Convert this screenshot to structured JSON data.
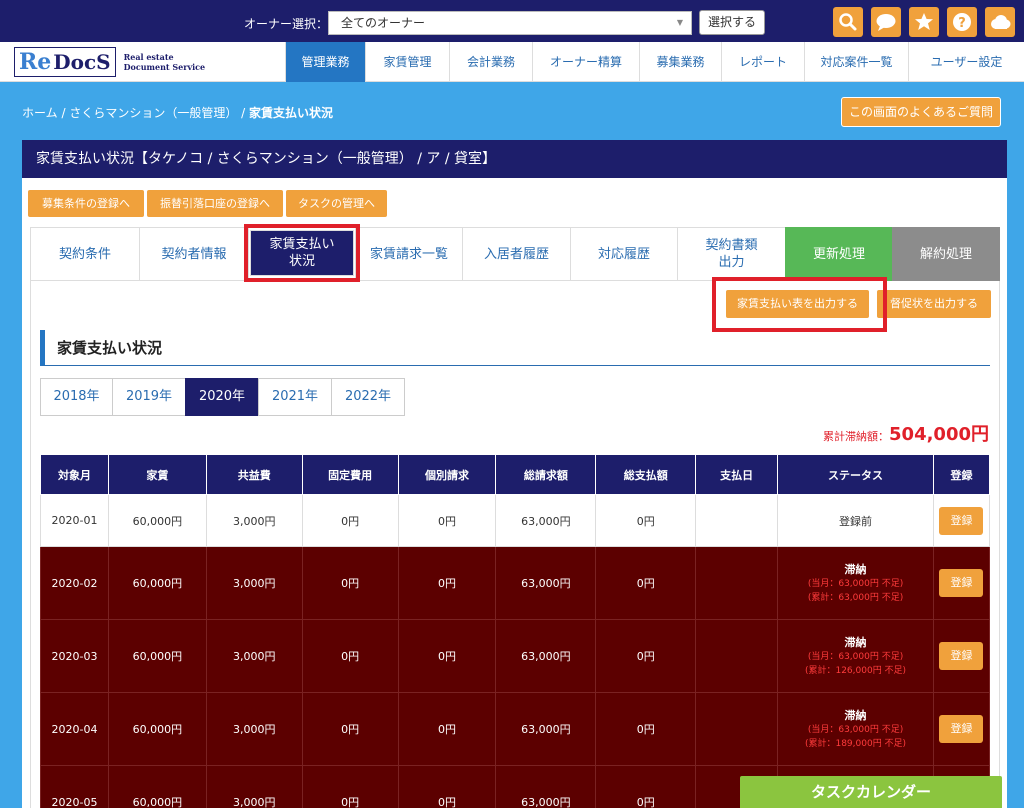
{
  "header": {
    "owner_label": "オーナー選択：",
    "owner_value": "全てのオーナー",
    "select_button": "選択する",
    "icons": [
      "search-icon",
      "chat-icon",
      "star-icon",
      "help-icon",
      "cloud-icon"
    ]
  },
  "logo": {
    "re": "Re",
    "docs": "DocS",
    "sub1": "Real estate",
    "sub2": "Document Service"
  },
  "nav": [
    "管理業務",
    "家賃管理",
    "会計業務",
    "オーナー精算",
    "募集業務",
    "レポート",
    "対応案件一覧",
    "ユーザー設定"
  ],
  "breadcrumb": {
    "home": "ホーム",
    "property": "さくらマンション（一般管理）",
    "current": "家賃支払い状況"
  },
  "faq_button": "この画面のよくあるご質問",
  "panel_title": "家賃支払い状況【タケノコ / さくらマンション（一般管理） / ア / 貸室】",
  "sub_buttons": [
    "募集条件の登録へ",
    "振替引落口座の登録へ",
    "タスクの管理へ"
  ],
  "tabs": [
    "契約条件",
    "契約者情報",
    "家賃支払い\n状況",
    "家賃請求一覧",
    "入居者履歴",
    "対応履歴",
    "契約書類\n出力",
    "更新処理",
    "解約処理"
  ],
  "actions": {
    "output_table": "家賃支払い表を出力する",
    "output_reminder": "督促状を出力する"
  },
  "section_title": "家賃支払い状況",
  "years": [
    "2018年",
    "2019年",
    "2020年",
    "2021年",
    "2022年"
  ],
  "total": {
    "label": "累計滞納額：",
    "value": "504,000円"
  },
  "table": {
    "headers": [
      "対象月",
      "家賃",
      "共益費",
      "固定費用",
      "個別請求",
      "総請求額",
      "総支払額",
      "支払日",
      "ステータス",
      "登録"
    ],
    "register_label": "登録",
    "rows": [
      {
        "month": "2020-01",
        "rent": "60,000円",
        "common": "3,000円",
        "fixed": "0円",
        "individual": "0円",
        "total_billed": "63,000円",
        "total_paid": "0円",
        "pay_date": "",
        "status": "登録前",
        "sub1": "",
        "sub2": ""
      },
      {
        "month": "2020-02",
        "rent": "60,000円",
        "common": "3,000円",
        "fixed": "0円",
        "individual": "0円",
        "total_billed": "63,000円",
        "total_paid": "0円",
        "pay_date": "",
        "status": "滞納",
        "sub1": "(当月：63,000円 不足)",
        "sub2": "(累計：63,000円 不足)"
      },
      {
        "month": "2020-03",
        "rent": "60,000円",
        "common": "3,000円",
        "fixed": "0円",
        "individual": "0円",
        "total_billed": "63,000円",
        "total_paid": "0円",
        "pay_date": "",
        "status": "滞納",
        "sub1": "(当月：63,000円 不足)",
        "sub2": "(累計：126,000円 不足)"
      },
      {
        "month": "2020-04",
        "rent": "60,000円",
        "common": "3,000円",
        "fixed": "0円",
        "individual": "0円",
        "total_billed": "63,000円",
        "total_paid": "0円",
        "pay_date": "",
        "status": "滞納",
        "sub1": "(当月：63,000円 不足)",
        "sub2": "(累計：189,000円 不足)"
      },
      {
        "month": "2020-05",
        "rent": "60,000円",
        "common": "3,000円",
        "fixed": "0円",
        "individual": "0円",
        "total_billed": "63,000円",
        "total_paid": "0円",
        "pay_date": "",
        "status": "",
        "sub1": "",
        "sub2": ""
      }
    ]
  },
  "task_calendar": "タスクカレンダー",
  "colors": {
    "navy": "#1d1e6b",
    "blue_bg": "#3fa6e8",
    "orange": "#f0a13c",
    "overdue": "#5c0000",
    "highlight": "#e0202a",
    "green": "#57b857",
    "gray": "#8c8c8c"
  }
}
